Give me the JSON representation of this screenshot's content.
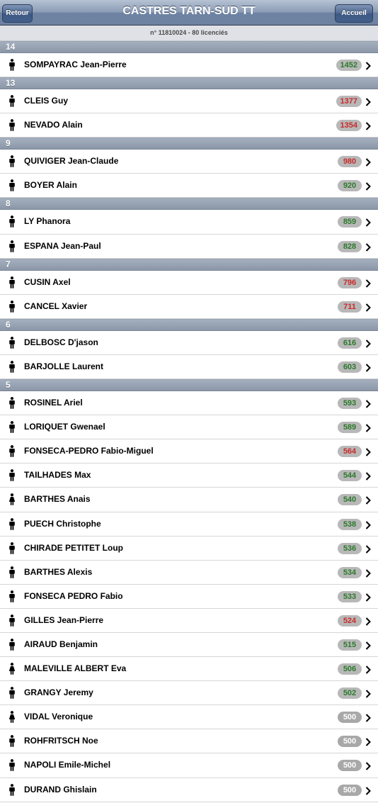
{
  "nav": {
    "title": "CASTRES TARN-SUD TT",
    "back_label": "Retour",
    "home_label": "Accueil"
  },
  "subheader": "n° 11810024 - 80 licenciés",
  "colors": {
    "up": "#2a7a2a",
    "down": "#cc2a2a",
    "neutral": "#ffffff"
  },
  "sections": [
    {
      "header": "14",
      "players": [
        {
          "name": "SOMPAYRAC Jean-Pierre",
          "points": "1452",
          "trend": "green",
          "gender": "male"
        }
      ]
    },
    {
      "header": "13",
      "players": [
        {
          "name": "CLEIS Guy",
          "points": "1377",
          "trend": "red",
          "gender": "male"
        },
        {
          "name": "NEVADO Alain",
          "points": "1354",
          "trend": "red",
          "gender": "male"
        }
      ]
    },
    {
      "header": "9",
      "players": [
        {
          "name": "QUIVIGER Jean-Claude",
          "points": "980",
          "trend": "red",
          "gender": "male"
        },
        {
          "name": "BOYER Alain",
          "points": "920",
          "trend": "green",
          "gender": "male"
        }
      ]
    },
    {
      "header": "8",
      "players": [
        {
          "name": "LY Phanora",
          "points": "859",
          "trend": "green",
          "gender": "male"
        },
        {
          "name": "ESPANA Jean-Paul",
          "points": "828",
          "trend": "green",
          "gender": "male"
        }
      ]
    },
    {
      "header": "7",
      "players": [
        {
          "name": "CUSIN Axel",
          "points": "796",
          "trend": "red",
          "gender": "male"
        },
        {
          "name": "CANCEL Xavier",
          "points": "711",
          "trend": "red",
          "gender": "male"
        }
      ]
    },
    {
      "header": "6",
      "players": [
        {
          "name": "DELBOSC D'jason",
          "points": "616",
          "trend": "green",
          "gender": "male"
        },
        {
          "name": "BARJOLLE Laurent",
          "points": "603",
          "trend": "green",
          "gender": "male"
        }
      ]
    },
    {
      "header": "5",
      "players": [
        {
          "name": "ROSINEL Ariel",
          "points": "593",
          "trend": "green",
          "gender": "male"
        },
        {
          "name": "LORIQUET Gwenael",
          "points": "589",
          "trend": "green",
          "gender": "male"
        },
        {
          "name": "FONSECA-PEDRO Fabio-Miguel",
          "points": "564",
          "trend": "red",
          "gender": "male"
        },
        {
          "name": "TAILHADES Max",
          "points": "544",
          "trend": "green",
          "gender": "male"
        },
        {
          "name": "BARTHES Anais",
          "points": "540",
          "trend": "green",
          "gender": "female"
        },
        {
          "name": "PUECH Christophe",
          "points": "538",
          "trend": "green",
          "gender": "male"
        },
        {
          "name": "CHIRADE PETITET Loup",
          "points": "536",
          "trend": "green",
          "gender": "male"
        },
        {
          "name": "BARTHES Alexis",
          "points": "534",
          "trend": "green",
          "gender": "male"
        },
        {
          "name": "FONSECA PEDRO Fabio",
          "points": "533",
          "trend": "green",
          "gender": "male"
        },
        {
          "name": "GILLES Jean-Pierre",
          "points": "524",
          "trend": "red",
          "gender": "male"
        },
        {
          "name": "AIRAUD Benjamin",
          "points": "515",
          "trend": "green",
          "gender": "male"
        },
        {
          "name": "MALEVILLE ALBERT Eva",
          "points": "506",
          "trend": "green",
          "gender": "female"
        },
        {
          "name": "GRANGY Jeremy",
          "points": "502",
          "trend": "green",
          "gender": "male"
        },
        {
          "name": "VIDAL Veronique",
          "points": "500",
          "trend": "white",
          "gender": "female"
        },
        {
          "name": "ROHFRITSCH Noe",
          "points": "500",
          "trend": "white",
          "gender": "male"
        },
        {
          "name": "NAPOLI Emile-Michel",
          "points": "500",
          "trend": "white",
          "gender": "male"
        },
        {
          "name": "DURAND Ghislain",
          "points": "500",
          "trend": "white",
          "gender": "male"
        }
      ]
    }
  ]
}
